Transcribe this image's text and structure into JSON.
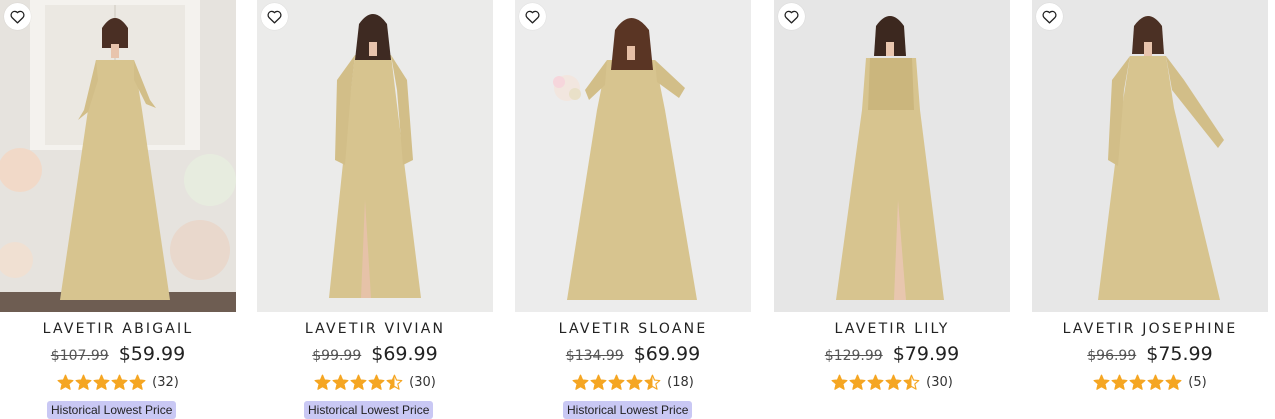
{
  "colors": {
    "accent": "#f5a623",
    "badge_bg": "#c9c8f4",
    "dress": "#d7c48f"
  },
  "products": [
    {
      "name": "LAVETIR ABIGAIL",
      "old_price": "$107.99",
      "price": "$59.99",
      "rating": 5,
      "reviews": "(32)",
      "badge": "Historical Lowest Price"
    },
    {
      "name": "LAVETIR VIVIAN",
      "old_price": "$99.99",
      "price": "$69.99",
      "rating": 4.5,
      "reviews": "(30)",
      "badge": "Historical Lowest Price"
    },
    {
      "name": "LAVETIR SLOANE",
      "old_price": "$134.99",
      "price": "$69.99",
      "rating": 4.5,
      "reviews": "(18)",
      "badge": "Historical Lowest Price"
    },
    {
      "name": "LAVETIR LILY",
      "old_price": "$129.99",
      "price": "$79.99",
      "rating": 4.5,
      "reviews": "(30)",
      "badge": ""
    },
    {
      "name": "LAVETIR JOSEPHINE",
      "old_price": "$96.99",
      "price": "$75.99",
      "rating": 5,
      "reviews": "(5)",
      "badge": ""
    }
  ]
}
